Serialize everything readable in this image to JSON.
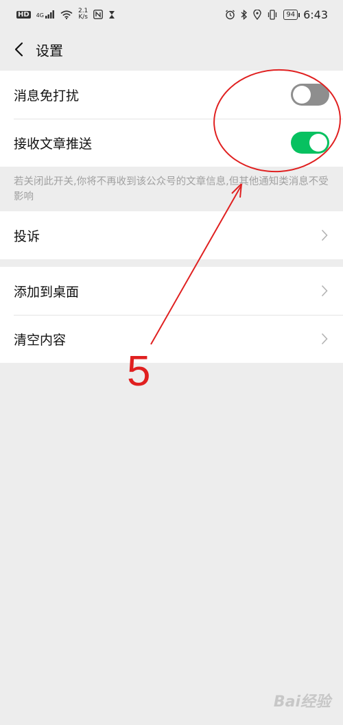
{
  "status_bar": {
    "hd": "HD",
    "network": "4G",
    "speed_value": "2.1",
    "speed_unit": "K/s",
    "battery": "94",
    "time": "6:43"
  },
  "nav": {
    "title": "设置",
    "back_icon": "chevron-left-icon"
  },
  "group1": {
    "items": [
      {
        "label": "消息免打扰",
        "switch_on": false
      },
      {
        "label": "接收文章推送",
        "switch_on": true
      }
    ]
  },
  "hint": "若关闭此开关,你将不再收到该公众号的文章信息,但其他通知类消息不受影响",
  "group2": {
    "items": [
      {
        "label": "投诉"
      }
    ]
  },
  "group3": {
    "items": [
      {
        "label": "添加到桌面"
      },
      {
        "label": "清空内容"
      }
    ]
  },
  "annotation": {
    "number": "5",
    "color": "#e02020"
  },
  "watermark": "Bai经验",
  "colors": {
    "switch_on": "#07c160",
    "switch_off": "#8e8e8e",
    "background": "#ededed"
  }
}
